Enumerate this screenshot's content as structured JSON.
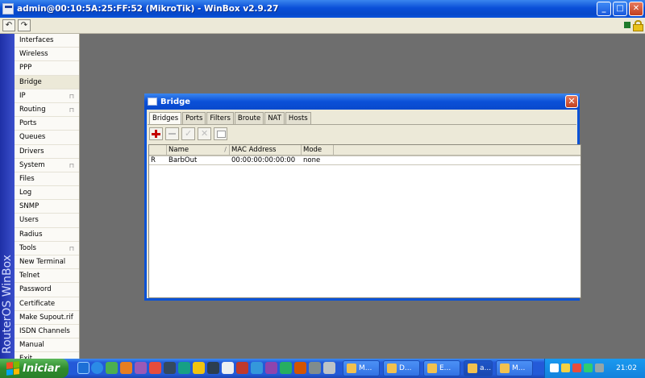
{
  "window": {
    "title": "admin@00:10:5A:25:FF:52 (MikroTik) - WinBox v2.9.27",
    "minimize": "_",
    "maximize": "□",
    "close": "✕"
  },
  "toolbar": {
    "undo": "↶",
    "redo": "↷"
  },
  "brand": "RouterOS WinBox",
  "menu": {
    "arrow": "⊓",
    "items": [
      {
        "label": "Interfaces"
      },
      {
        "label": "Wireless"
      },
      {
        "label": "PPP"
      },
      {
        "label": "Bridge",
        "selected": true
      },
      {
        "label": "IP",
        "submenu": true
      },
      {
        "label": "Routing",
        "submenu": true
      },
      {
        "label": "Ports"
      },
      {
        "label": "Queues"
      },
      {
        "label": "Drivers"
      },
      {
        "label": "System",
        "submenu": true
      },
      {
        "label": "Files"
      },
      {
        "label": "Log"
      },
      {
        "label": "SNMP"
      },
      {
        "label": "Users"
      },
      {
        "label": "Radius"
      },
      {
        "label": "Tools",
        "submenu": true
      },
      {
        "label": "New Terminal"
      },
      {
        "label": "Telnet"
      },
      {
        "label": "Password"
      },
      {
        "label": "Certificate"
      },
      {
        "label": "Make Supout.rif"
      },
      {
        "label": "ISDN Channels"
      },
      {
        "label": "Manual"
      },
      {
        "label": "Exit"
      }
    ]
  },
  "dialog": {
    "title": "Bridge",
    "close": "✕",
    "tabs": [
      "Bridges",
      "Ports",
      "Filters",
      "Broute",
      "NAT",
      "Hosts"
    ],
    "active_tab": 0,
    "table": {
      "headers": [
        "",
        "Name",
        "MAC Address",
        "Mode"
      ],
      "sort_indicator": "/",
      "rows": [
        {
          "flag": "R",
          "name": "BarbOut",
          "mac": "00:00:00:00:00:00",
          "mode": "none"
        }
      ]
    }
  },
  "taskbar": {
    "start_label": "Iniciar",
    "tasks": [
      {
        "label": "M..."
      },
      {
        "label": "D..."
      },
      {
        "label": "E..."
      },
      {
        "label": "a..."
      },
      {
        "label": "M..."
      }
    ],
    "clock": "21:02"
  },
  "colors": {
    "titlebar": "#0a4fd8",
    "desktop": "#6e6e6e",
    "start": "#2f8c2e",
    "tray": "#1282dc"
  }
}
